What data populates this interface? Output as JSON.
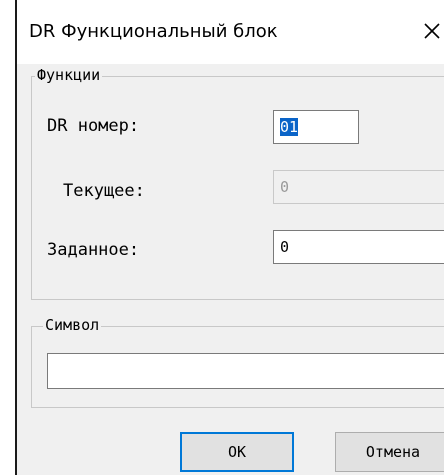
{
  "window": {
    "title": "DR Функциональный блок"
  },
  "functions_group": {
    "legend": "Функции",
    "dr_number": {
      "label": "DR номер:",
      "value": "01"
    },
    "current": {
      "label": "Текущее:",
      "value": "0"
    },
    "setpoint": {
      "label": "Заданное:",
      "value": "0"
    }
  },
  "symbol_group": {
    "legend": "Символ",
    "value": ""
  },
  "buttons": {
    "ok_label": "OK",
    "cancel_label": "Отмена"
  },
  "icons": {
    "close": "close-icon"
  },
  "colors": {
    "selection": "#0a64c8",
    "default_button_border": "#0078d7",
    "dialog_bg": "#f0f0f0"
  }
}
